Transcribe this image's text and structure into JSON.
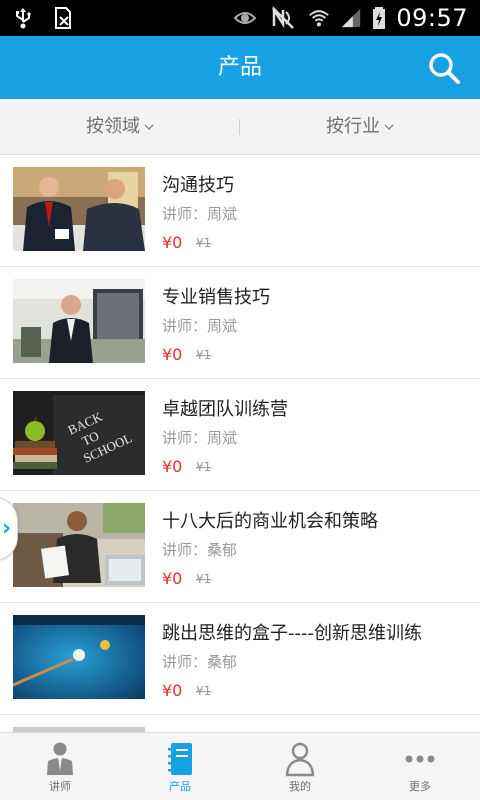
{
  "status_bar": {
    "time": "09:57",
    "icons": [
      "usb-icon",
      "sim-icon",
      "eye-icon",
      "no-signal-icon",
      "wifi-icon",
      "signal-icon",
      "battery-charging-icon"
    ]
  },
  "header": {
    "title": "产品",
    "search_icon": "search-icon",
    "accent": "#17a0e3"
  },
  "filters": {
    "by_domain": "按领域",
    "by_industry": "按行业"
  },
  "products": [
    {
      "title": "沟通技巧",
      "teacher": "讲师：周斌",
      "price": "¥0",
      "original_price": "¥1"
    },
    {
      "title": "专业销售技巧",
      "teacher": "讲师：周斌",
      "price": "¥0",
      "original_price": "¥1"
    },
    {
      "title": "卓越团队训练营",
      "teacher": "讲师：周斌",
      "price": "¥0",
      "original_price": "¥1"
    },
    {
      "title": "十八大后的商业机会和策略",
      "teacher": "讲师：桑郁",
      "price": "¥0",
      "original_price": "¥1"
    },
    {
      "title": "跳出思维的盒子----创新思维训练",
      "teacher": "讲师：桑郁",
      "price": "¥0",
      "original_price": "¥1"
    }
  ],
  "side_tab": {
    "glyph": "›"
  },
  "bottom_nav": {
    "tabs": [
      {
        "label": "讲师",
        "icon": "teacher-icon"
      },
      {
        "label": "产品",
        "icon": "notebook-icon"
      },
      {
        "label": "我的",
        "icon": "user-icon"
      },
      {
        "label": "更多",
        "icon": "more-icon"
      }
    ],
    "active": "产品"
  }
}
